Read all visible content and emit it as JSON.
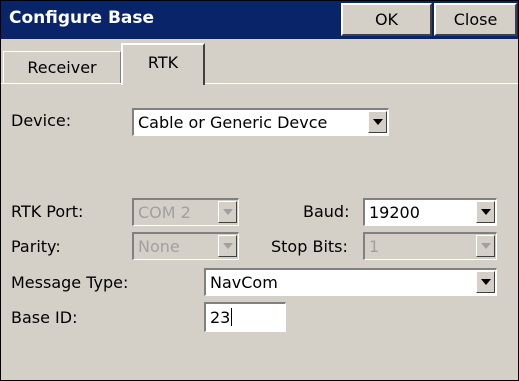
{
  "window": {
    "title": "Configure Base",
    "ok_label": "OK",
    "close_label": "Close"
  },
  "tabs": [
    {
      "label": "Receiver",
      "active": false
    },
    {
      "label": "RTK",
      "active": true
    }
  ],
  "form": {
    "device": {
      "label": "Device:",
      "value": "Cable or Generic Devce"
    },
    "rtk_port": {
      "label": "RTK Port:",
      "value": "COM 2",
      "enabled": false
    },
    "baud": {
      "label": "Baud:",
      "value": "19200",
      "enabled": true
    },
    "parity": {
      "label": "Parity:",
      "value": "None",
      "enabled": false
    },
    "stop_bits": {
      "label": "Stop Bits:",
      "value": "1",
      "enabled": false
    },
    "message_type": {
      "label": "Message Type:",
      "value": "NavCom"
    },
    "base_id": {
      "label": "Base ID:",
      "value": "23"
    }
  },
  "colors": {
    "titlebar": "#0a246a",
    "face": "#d4d0c8",
    "disabled_text": "#a0a0a0"
  },
  "icons": [
    "dropdown-arrow-icon"
  ]
}
